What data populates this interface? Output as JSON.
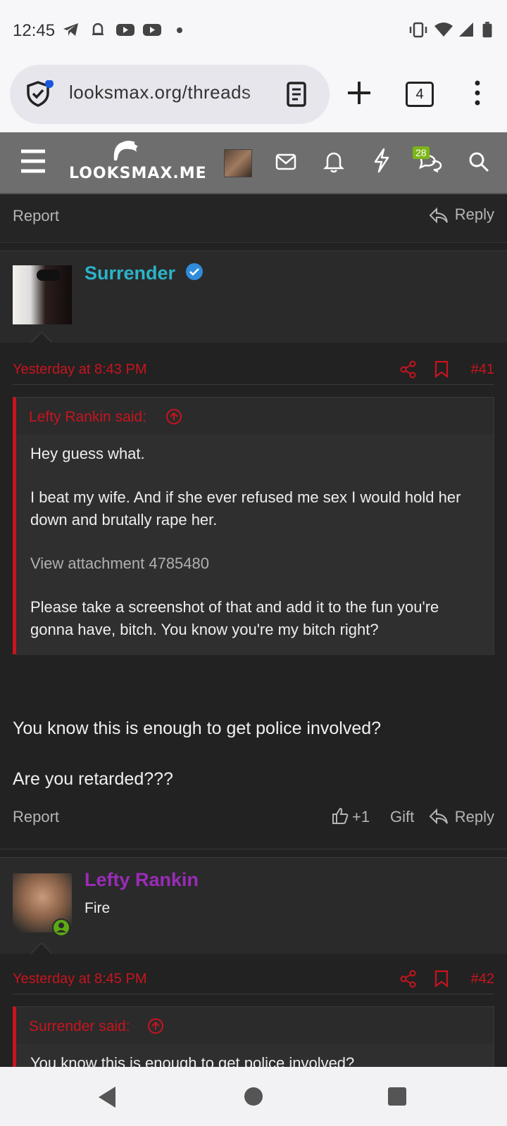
{
  "status_bar": {
    "time": "12:45"
  },
  "browser": {
    "url": "looksmax.org/threads",
    "tab_count": "4"
  },
  "site": {
    "logo_text": "LOOKSMAX.ME",
    "notification_badge": "28"
  },
  "prev_post": {
    "report_label": "Report",
    "reply_label": "Reply"
  },
  "post41": {
    "username": "Surrender",
    "timestamp": "Yesterday at 8:43 PM",
    "number": "#41",
    "quote": {
      "author_line": "Lefty Rankin said:",
      "paragraphs": [
        "Hey guess what.",
        "I beat my wife. And if she ever refused me sex I would hold her down and brutally rape her.",
        "View attachment 4785480",
        "Please take a screenshot of that and add it to the fun you're gonna have, bitch. You know you're my bitch right?"
      ]
    },
    "body": [
      "You know this is enough to get police involved?",
      "Are you retarded???"
    ],
    "actions": {
      "report": "Report",
      "like_count": "+1",
      "gift": "Gift",
      "reply": "Reply"
    }
  },
  "post42": {
    "username": "Lefty Rankin",
    "user_title": "Fire",
    "timestamp": "Yesterday at 8:45 PM",
    "number": "#42",
    "quote": {
      "author_line": "Surrender said:",
      "first_line": "You know this is enough to get police involved?"
    }
  },
  "colors": {
    "accent_red": "#c8141e",
    "username_cyan": "#2bb3c9",
    "username_purple": "#9b2bb8",
    "online_green": "#5ca914"
  }
}
